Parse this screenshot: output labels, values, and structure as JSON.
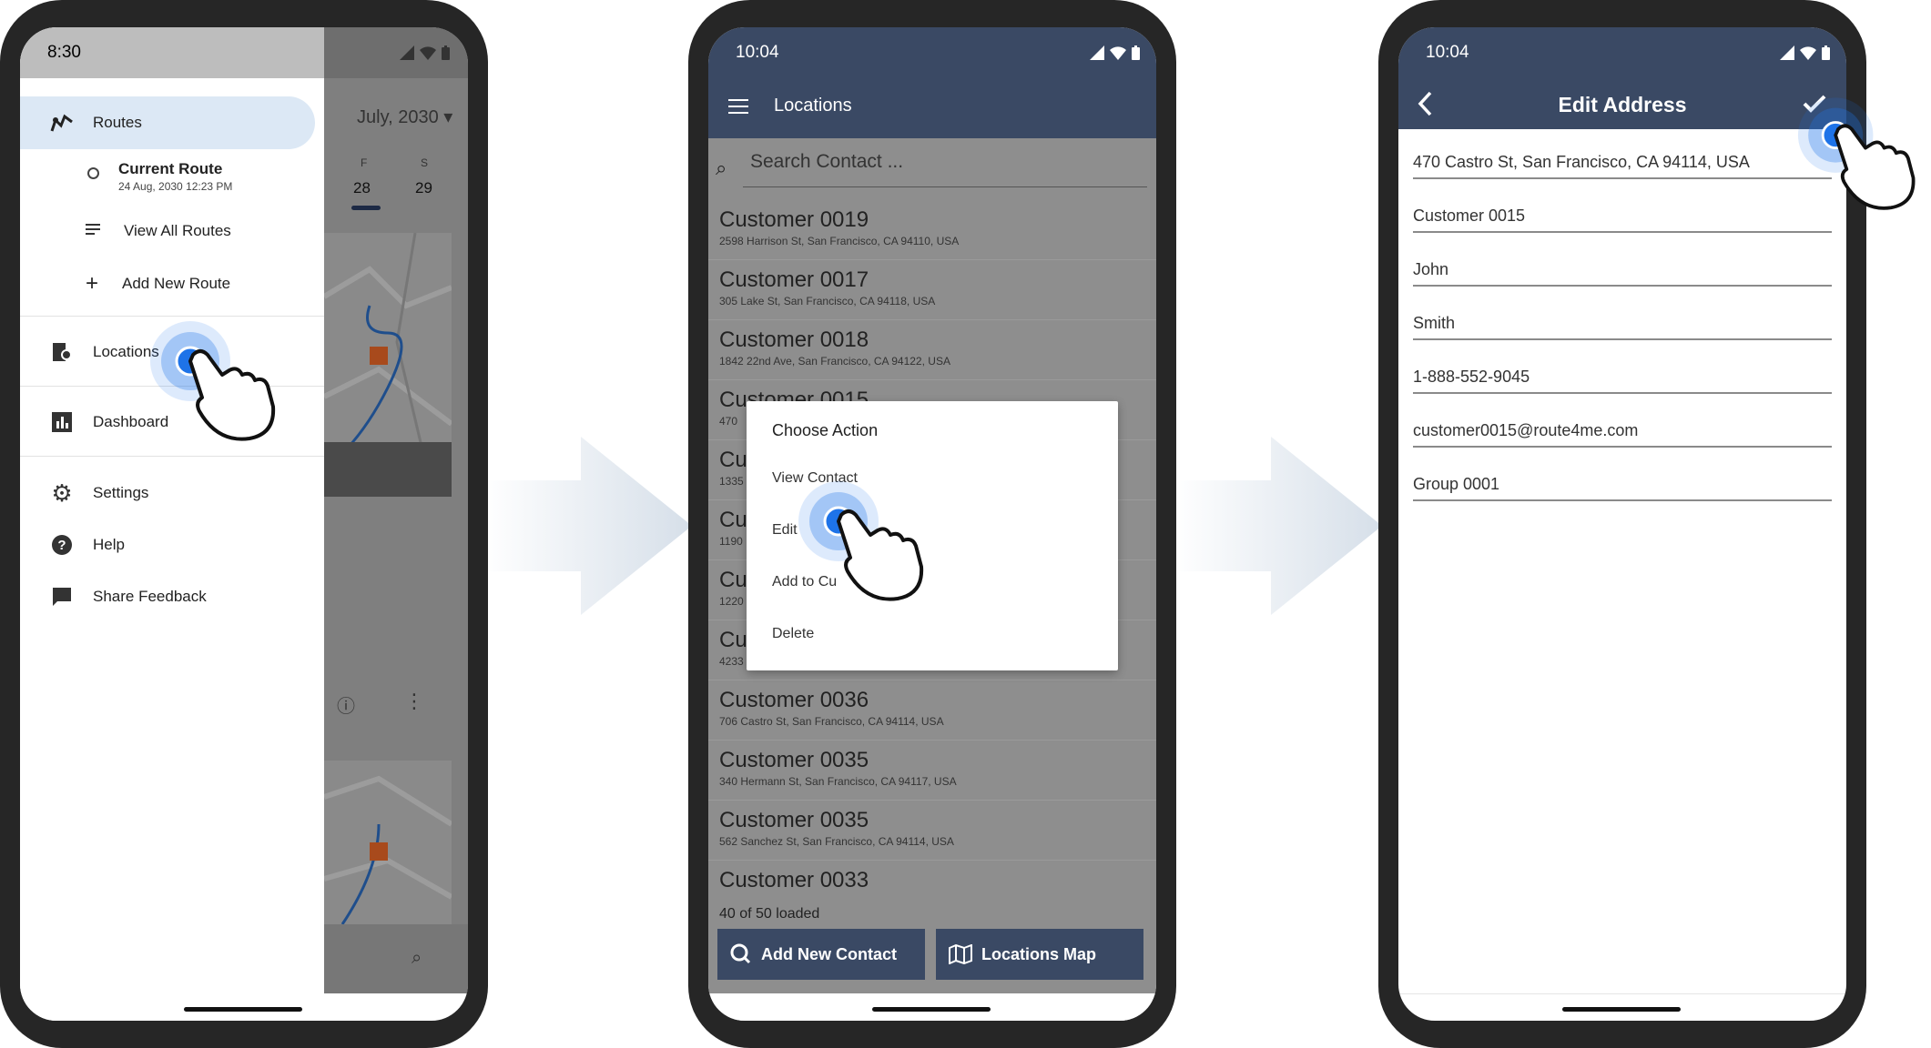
{
  "phone1": {
    "time": "8:30",
    "calendar_month": "July, 2030",
    "day_labels": [
      "F",
      "S"
    ],
    "day_numbers": [
      "28",
      "29"
    ],
    "menu": {
      "routes": "Routes",
      "current_route_title": "Current Route",
      "current_route_date": "24 Aug, 2030 12:23 PM",
      "view_all_routes": "View All Routes",
      "add_new_route": "Add New Route",
      "locations": "Locations",
      "dashboard": "Dashboard",
      "settings": "Settings",
      "help": "Help",
      "share_feedback": "Share Feedback"
    }
  },
  "phone2": {
    "time": "10:04",
    "title": "Locations",
    "search_placeholder": "Search Contact ...",
    "contacts": [
      {
        "name": "Customer 0019",
        "address": "2598 Harrison St, San Francisco, CA 94110, USA"
      },
      {
        "name": "Customer 0017",
        "address": "305 Lake St, San Francisco, CA 94118, USA"
      },
      {
        "name": "Customer 0018",
        "address": "1842 22nd Ave, San Francisco, CA 94122, USA"
      },
      {
        "name": "Customer 0015",
        "address": "470"
      },
      {
        "name": "Cu",
        "address": "1335"
      },
      {
        "name": "Cu",
        "address": "1190"
      },
      {
        "name": "Cu",
        "address": "1220"
      },
      {
        "name": "Cu",
        "address": "4233"
      },
      {
        "name": "Customer 0036",
        "address": "706 Castro St, San Francisco, CA 94114, USA"
      },
      {
        "name": "Customer 0035",
        "address": "340 Hermann St, San Francisco, CA 94117, USA"
      },
      {
        "name": "Customer 0035",
        "address": "562 Sanchez St, San Francisco, CA 94114, USA"
      },
      {
        "name": "Customer 0033",
        "address": ""
      }
    ],
    "loaded_status": "40 of 50 loaded",
    "dialog": {
      "title": "Choose Action",
      "view_contact": "View Contact",
      "edit": "Edit",
      "add_to": "Add to Cu",
      "delete": "Delete"
    },
    "add_new_contact": "Add New Contact",
    "locations_map": "Locations Map"
  },
  "phone3": {
    "time": "10:04",
    "title": "Edit Address",
    "fields": {
      "address": "470 Castro St, San Francisco, CA 94114, USA",
      "alias": "Customer 0015",
      "first_name": "John",
      "last_name": "Smith",
      "phone": "1-888-552-9045",
      "email": "customer0015@route4me.com",
      "group": "Group 0001"
    }
  },
  "colors": {
    "app_bar": "#3a4964",
    "selected_item": "#dce8f5",
    "touch": "#1e73e8",
    "arrow": "#d9e2ec"
  }
}
